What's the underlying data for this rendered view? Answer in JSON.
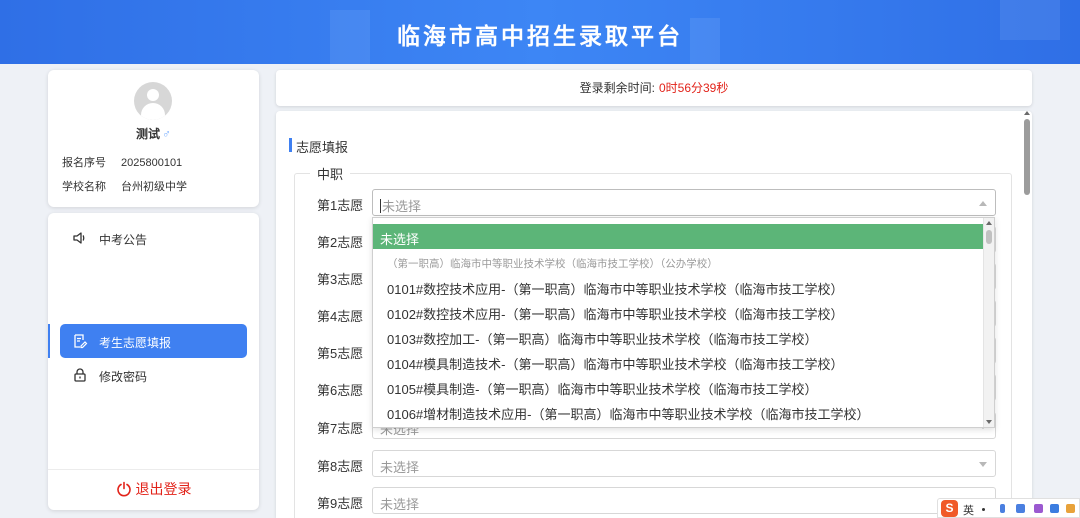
{
  "header": {
    "title": "临海市高中招生录取平台"
  },
  "profile": {
    "name": "测试",
    "gender_icon": "♂",
    "reg_label": "报名序号",
    "reg_value": "2025800101",
    "school_label": "学校名称",
    "school_value": "台州初级中学"
  },
  "menu": {
    "items": [
      {
        "label": "中考公告",
        "icon": "speaker-icon"
      },
      {
        "label": "考生志愿填报",
        "icon": "edit-icon"
      },
      {
        "label": "修改密码",
        "icon": "lock-icon"
      }
    ],
    "logout_label": "退出登录",
    "active_color": "#3f80f1"
  },
  "topbar": {
    "label": "登录剩余时间:",
    "remaining": "0时56分39秒"
  },
  "form": {
    "section_title": "志愿填报",
    "group_label": "中职",
    "placeholder": "未选择",
    "choices": [
      {
        "label": "第1志愿",
        "value": "未选择"
      },
      {
        "label": "第2志愿",
        "value": ""
      },
      {
        "label": "第3志愿",
        "value": ""
      },
      {
        "label": "第4志愿",
        "value": ""
      },
      {
        "label": "第5志愿",
        "value": ""
      },
      {
        "label": "第6志愿",
        "value": ""
      },
      {
        "label": "第7志愿",
        "value": "未选择"
      },
      {
        "label": "第8志愿",
        "value": "未选择"
      },
      {
        "label": "第9志愿",
        "value": "未选择"
      }
    ]
  },
  "dropdown": {
    "options": [
      "未选择",
      "（第一职高）临海市中等职业技术学校（临海市技工学校）（公办学校）",
      "0101#数控技术应用-（第一职高）临海市中等职业技术学校（临海市技工学校）",
      "0102#数控技术应用-（第一职高）临海市中等职业技术学校（临海市技工学校）",
      "0103#数控加工-（第一职高）临海市中等职业技术学校（临海市技工学校）",
      "0104#模具制造技术-（第一职高）临海市中等职业技术学校（临海市技工学校）",
      "0105#模具制造-（第一职高）临海市中等职业技术学校（临海市技工学校）",
      "0106#增材制造技术应用-（第一职高）临海市中等职业技术学校（临海市技工学校）"
    ],
    "selected_color": "#5cb578"
  },
  "ime": {
    "mode": "英"
  }
}
